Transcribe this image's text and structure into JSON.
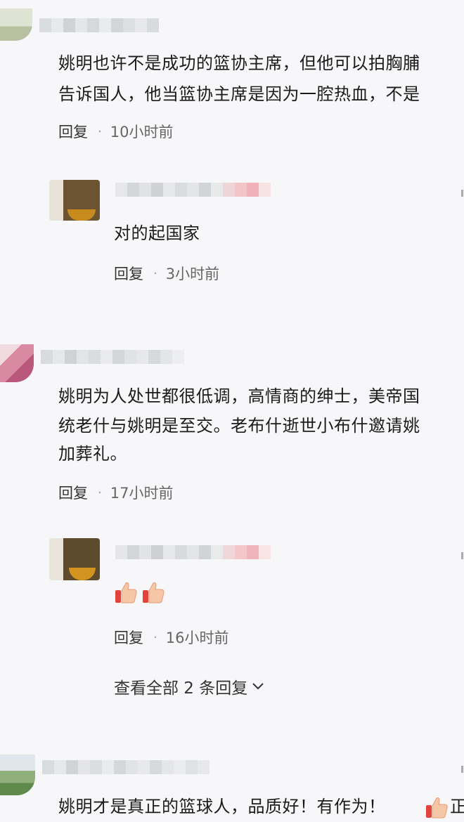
{
  "comments": [
    {
      "text_lines": [
        "姚明也许不是成功的篮协主席，但他可以拍胸脯",
        "告诉国人，他当篮协主席是因为一腔热血，不是"
      ],
      "reply_label": "回复",
      "time": "10小时前",
      "reply": {
        "text": "对的起国家",
        "reply_label": "回复",
        "time": "3小时前"
      }
    },
    {
      "text_lines": [
        "姚明为人处世都很低调，高情商的绅士，美帝国",
        "统老什与姚明是至交。老布什逝世小布什邀请姚",
        "加葬礼。"
      ],
      "reply_label": "回复",
      "time": "17小时前",
      "reply": {
        "text": "",
        "reply_label": "回复",
        "time": "16小时前",
        "more_label": "查看全部 2 条回复"
      }
    },
    {
      "text_lines": [
        "姚明才是真正的篮球人，品质好！有作为！",
        "正"
      ]
    }
  ],
  "colors": {
    "background": "#f7f7f9",
    "text": "#1b1b1b",
    "meta": "#666666"
  },
  "icons": [
    "thumbs-up-icon",
    "chevron-down-icon"
  ]
}
